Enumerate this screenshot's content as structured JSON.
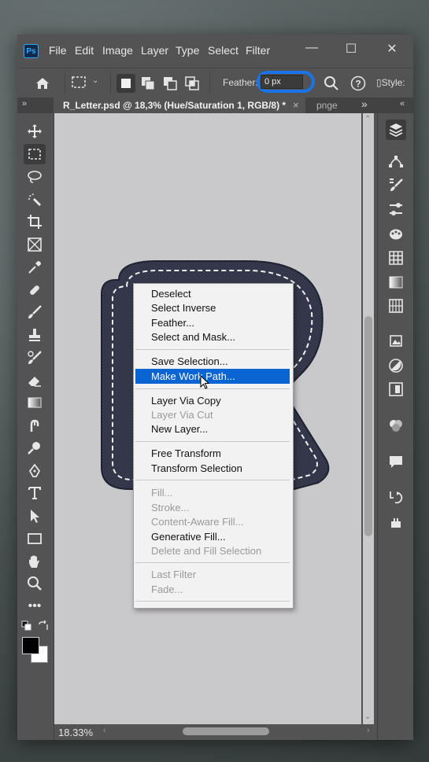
{
  "app": {
    "logo": "Ps",
    "menu": [
      "File",
      "Edit",
      "Image",
      "Layer",
      "Type",
      "Select",
      "Filter"
    ],
    "window_controls": [
      "minimize-icon",
      "maximize-icon",
      "close-icon"
    ]
  },
  "options": {
    "feather_label": "Feather:",
    "feather_value": "0 px",
    "style_label": "Style:"
  },
  "tabs": {
    "active": "R_Letter.psd @ 18,3% (Hue/Saturation 1, RGB/8) *",
    "close": "×",
    "next": "pnge",
    "overflow": "»",
    "collapse_left": "»",
    "collapse_right": "«"
  },
  "status": {
    "zoom": "18.33%"
  },
  "context_menu": {
    "groups": [
      [
        "Deselect",
        "Select Inverse",
        "Feather...",
        "Select and Mask..."
      ],
      [
        "Save Selection...",
        "Make Work Path..."
      ],
      [
        "Layer Via Copy",
        "Layer Via Cut",
        "New Layer..."
      ],
      [
        "Free Transform",
        "Transform Selection"
      ],
      [
        "Fill...",
        "Stroke...",
        "Content-Aware Fill...",
        "Generative Fill...",
        "Delete and Fill Selection"
      ],
      [
        "Last Filter",
        "Fade..."
      ]
    ],
    "highlighted": "Make Work Path...",
    "disabled": [
      "Layer Via Cut",
      "Fill...",
      "Stroke...",
      "Content-Aware Fill...",
      "Delete and Fill Selection",
      "Last Filter",
      "Fade..."
    ]
  },
  "colors": {
    "chrome": "#535353",
    "canvas": "#c9c8cb",
    "highlight": "#0a64d2",
    "accent": "#31a8ff",
    "denim": "#2e3142"
  }
}
